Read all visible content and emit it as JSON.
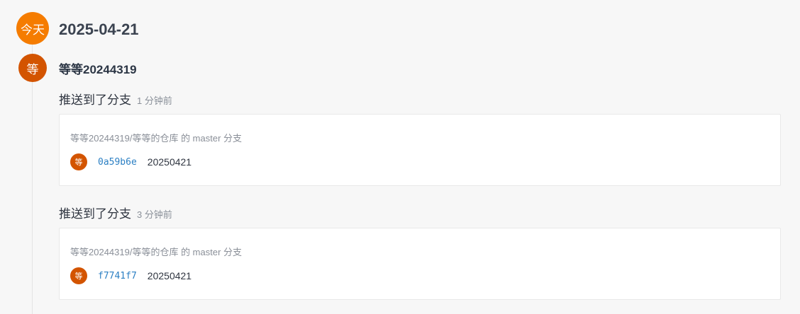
{
  "timeline": {
    "today_label": "今天",
    "date": "2025-04-21",
    "user": {
      "avatar_char": "等",
      "name": "等等20244319"
    },
    "events": [
      {
        "action": "推送到了分支",
        "time": "1 分钟前",
        "repo_line": "等等20244319/等等的仓库 的 master 分支",
        "commit": {
          "avatar_char": "等",
          "sha": "0a59b6e",
          "message": "20250421"
        }
      },
      {
        "action": "推送到了分支",
        "time": "3 分钟前",
        "repo_line": "等等20244319/等等的仓库 的 master 分支",
        "commit": {
          "avatar_char": "等",
          "sha": "f7741f7",
          "message": "20250421"
        }
      }
    ]
  }
}
